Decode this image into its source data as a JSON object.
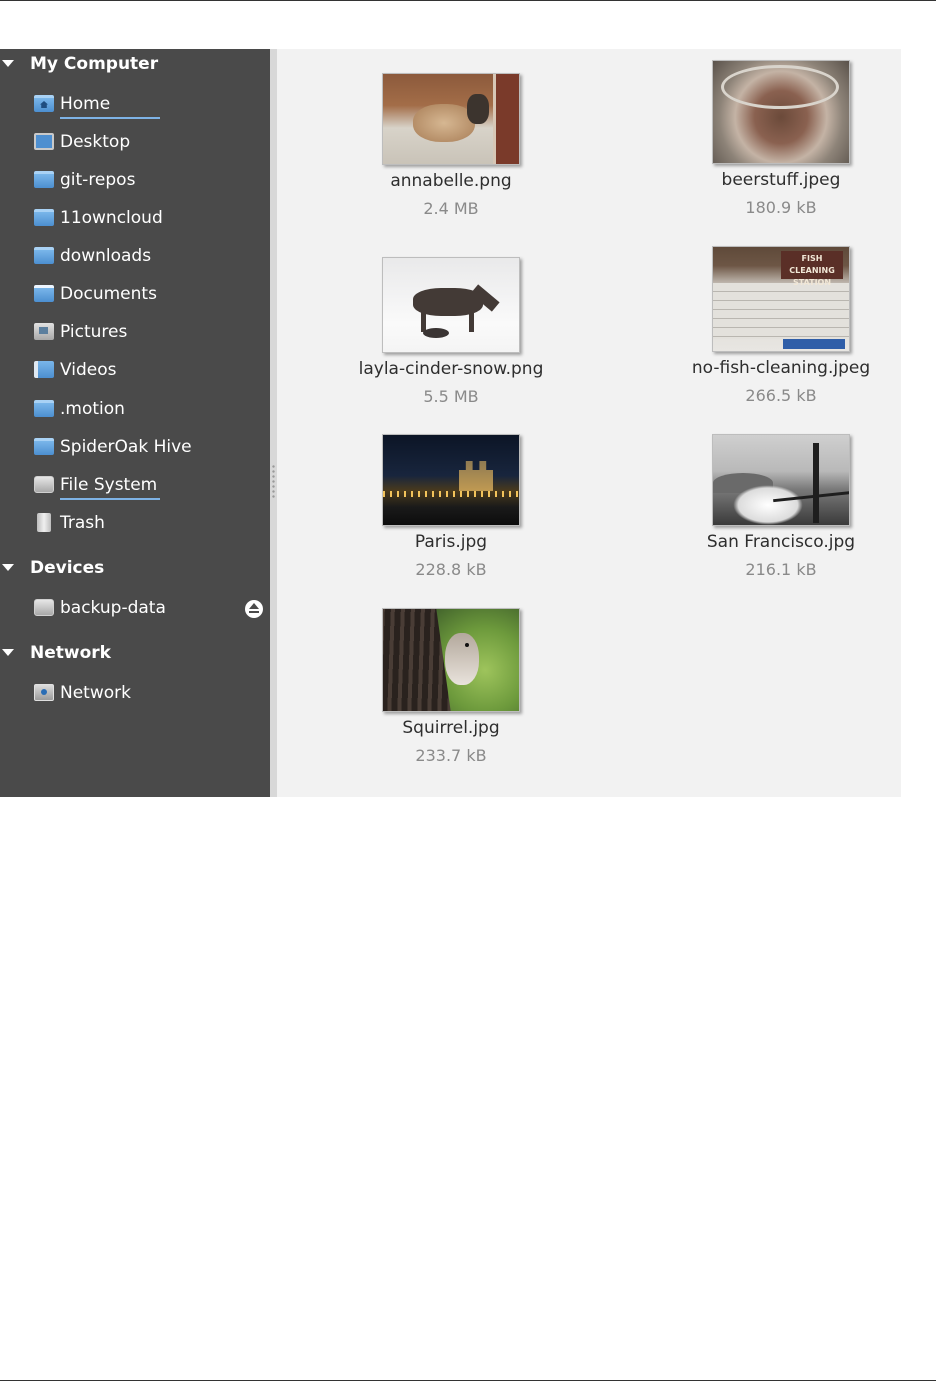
{
  "sidebar": {
    "sections": [
      {
        "title": "My Computer",
        "items": [
          {
            "label": "Home",
            "icon": "home-folder-icon"
          },
          {
            "label": "Desktop",
            "icon": "desktop-icon"
          },
          {
            "label": "git-repos",
            "icon": "folder-icon"
          },
          {
            "label": "11owncloud",
            "icon": "folder-icon"
          },
          {
            "label": "downloads",
            "icon": "folder-icon"
          },
          {
            "label": "Documents",
            "icon": "documents-folder-icon"
          },
          {
            "label": "Pictures",
            "icon": "pictures-folder-icon"
          },
          {
            "label": "Videos",
            "icon": "videos-folder-icon"
          },
          {
            "label": ".motion",
            "icon": "folder-icon"
          },
          {
            "label": "SpiderOak Hive",
            "icon": "folder-icon"
          },
          {
            "label": "File System",
            "icon": "drive-icon"
          },
          {
            "label": "Trash",
            "icon": "trash-icon"
          }
        ]
      },
      {
        "title": "Devices",
        "items": [
          {
            "label": "backup-data",
            "icon": "drive-icon",
            "action_icon": "eject-icon"
          }
        ]
      },
      {
        "title": "Network",
        "items": [
          {
            "label": "Network",
            "icon": "network-icon"
          }
        ]
      }
    ]
  },
  "files": [
    {
      "name": "annabelle.png",
      "size": "2.4 MB"
    },
    {
      "name": "beerstuff.jpeg",
      "size": "180.9 kB"
    },
    {
      "name": "layla-cinder-snow.png",
      "size": "5.5 MB"
    },
    {
      "name": "no-fish-cleaning.jpeg",
      "size": "266.5 kB",
      "thumbnail_sign_text": "FISH CLEANING STATION"
    },
    {
      "name": "Paris.jpg",
      "size": "228.8 kB"
    },
    {
      "name": "San Francisco.jpg",
      "size": "216.1 kB"
    },
    {
      "name": "Squirrel.jpg",
      "size": "233.7 kB"
    }
  ],
  "colors": {
    "sidebar_bg": "#4a4a4a",
    "files_bg": "#f2f2f2",
    "accent_underline": "#7eb3e6",
    "folder_blue": "#4c8fd0"
  }
}
